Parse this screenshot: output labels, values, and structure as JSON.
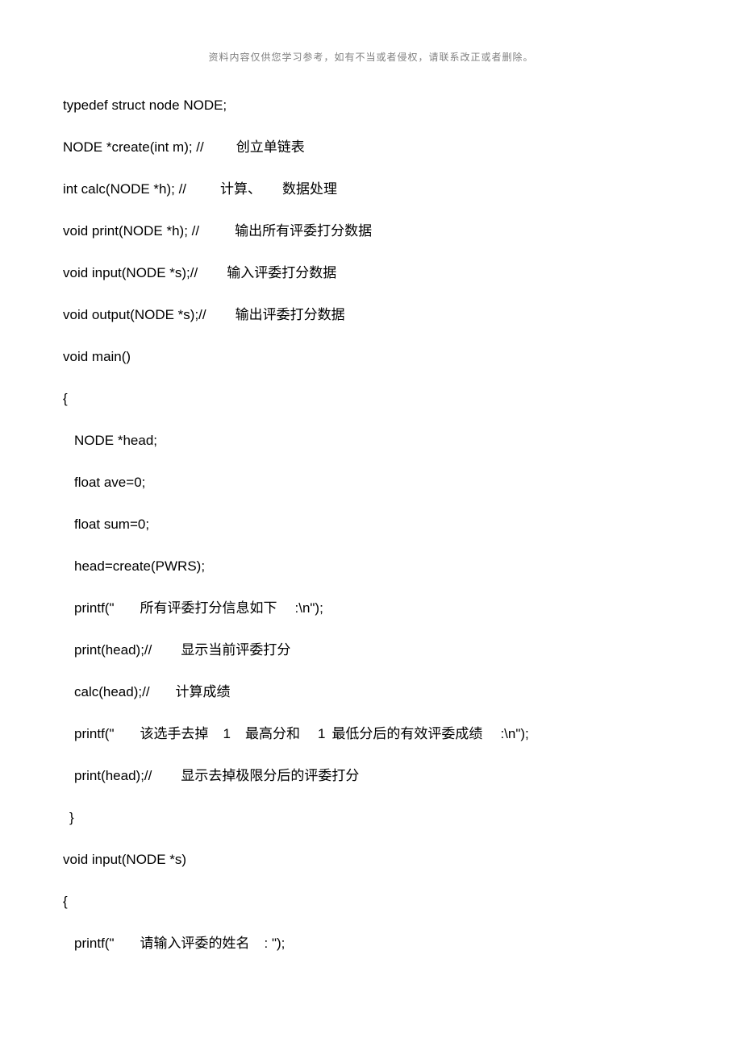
{
  "header": "资料内容仅供您学习参考，如有不当或者侵权，请联系改正或者删除。",
  "lines": {
    "l1": "typedef struct node NODE;",
    "l2a": "NODE *create(int m); //",
    "l2b": "创立单链表",
    "l3a": "int calc(NODE *h); //",
    "l3b": "计算、",
    "l3c": "数据处理",
    "l4a": "void print(NODE *h); //",
    "l4b": "输出所有评委打分数据",
    "l5a": "void input(NODE *s);//",
    "l5b": "输入评委打分数据",
    "l6a": "void output(NODE *s);//",
    "l6b": "输出评委打分数据",
    "l7": "void main()",
    "l8": "{",
    "l9": "NODE *head;",
    "l10": "float ave=0;",
    "l11": "float sum=0;",
    "l12": "head=create(PWRS);",
    "l13a": "printf(\"",
    "l13b": "所有评委打分信息如下",
    "l13c": ":\\n\");",
    "l14a": "print(head);//",
    "l14b": "显示当前评委打分",
    "l15a": "calc(head);//",
    "l15b": "计算成绩",
    "l16a": "printf(\"",
    "l16b": "该选手去掉",
    "l16c": "1",
    "l16d": "最高分和",
    "l16e": "1",
    "l16f": "最低分后的有效评委成绩",
    "l16g": ":\\n\");",
    "l17a": "print(head);//",
    "l17b": "显示去掉极限分后的评委打分",
    "l18": "}",
    "l19": "void input(NODE *s)",
    "l20": "{",
    "l21a": "printf(\"",
    "l21b": "请输入评委的姓名",
    "l21c": ": \");"
  }
}
